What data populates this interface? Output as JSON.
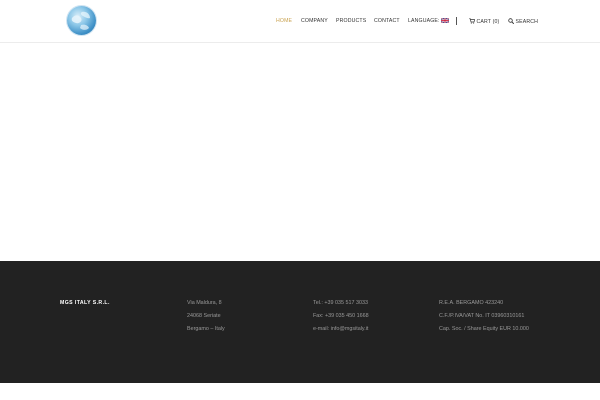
{
  "header": {
    "logo_icon": "globe-logo-icon",
    "nav": {
      "home": "HOME",
      "company": "COMPANY",
      "products": "PRODUCTS",
      "contact": "CONTACT",
      "language": "LANGUAGE:",
      "language_flag": "uk-flag-icon",
      "cart": "CART (0)",
      "cart_icon": "cart-icon",
      "search": "SEARCH",
      "search_icon": "search-icon"
    },
    "active_color": "#c9a24f"
  },
  "footer": {
    "company_name": "MGS ITALY S.R.L.",
    "address": [
      "Via Maldura, 8",
      "24068 Seriate",
      "Bergamo – Italy"
    ],
    "contact": [
      "Tel.: +39 035 517 3033",
      "Fax: +39 035 450 1668",
      "e-mail: info@mgsitaly.it"
    ],
    "legal": [
      "R.E.A. BERGAMO 423240",
      "C.F./P.IVA/VAT No. IT 03960310161",
      "Cap. Soc. / Share Equity EUR 10.000"
    ],
    "background": "#222222"
  }
}
